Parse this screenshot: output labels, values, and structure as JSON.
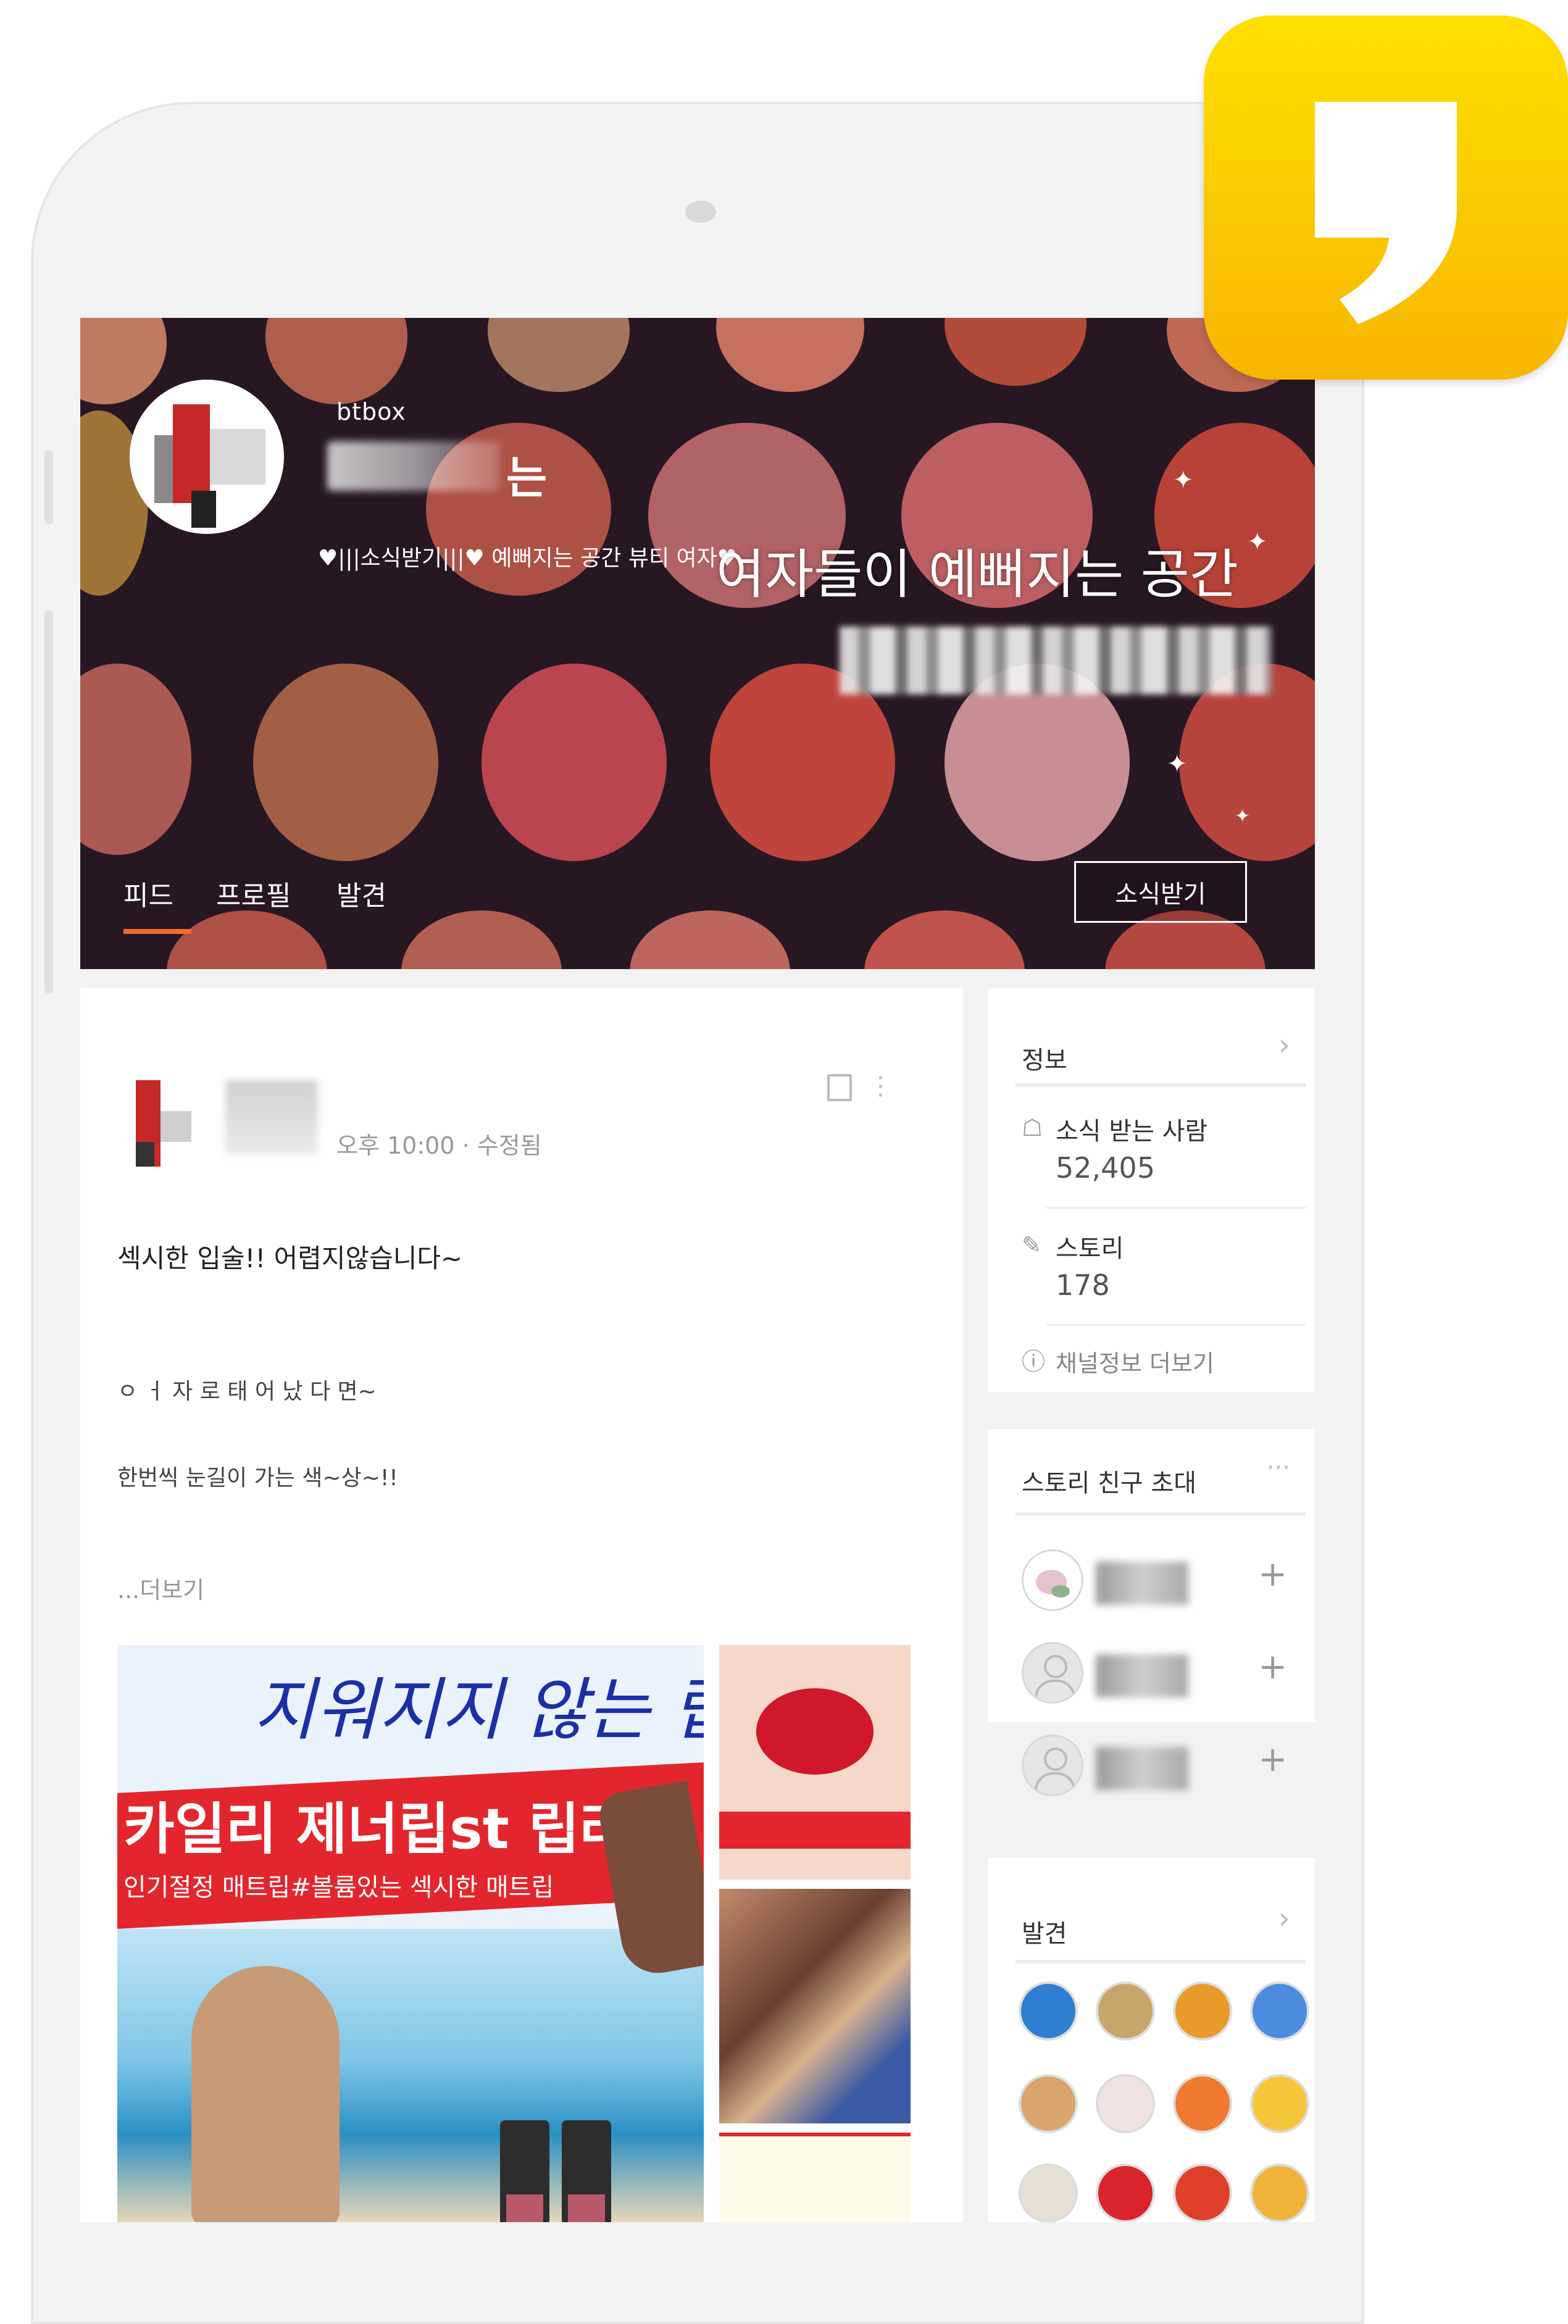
{
  "channel": {
    "id": "btbox",
    "name_tail": "는",
    "description": "♥|||소식받기|||♥ 예뻐지는 공간 뷰티 여자♥",
    "cover_headline": "여자들이 예뻐지는 공간",
    "tabs": [
      {
        "label": "피드"
      },
      {
        "label": "프로필"
      },
      {
        "label": "발견"
      }
    ],
    "subscribe_label": "소식받기"
  },
  "post": {
    "time": "오후 10:00 · 수정됨",
    "lines": [
      "섹시한 입술!! 어렵지않습니다~",
      "ㅇ ㅓ 자 로 태 어 났 다 면~",
      "한번씩 눈길이 가는 색~상~!!"
    ],
    "more_label": "...더보기",
    "image": {
      "headline": "지워지지 않는 립",
      "band_title": "카일리 제너립st 립라커",
      "band_sub": "인기절정 매트립#볼륨있는 섹시한 매트립"
    }
  },
  "info_card": {
    "title": "정보",
    "subscribers_label": "소식 받는 사람",
    "subscribers_value": "52,405",
    "stories_label": "스토리",
    "stories_value": "178",
    "more_label": "채널정보 더보기"
  },
  "invite_card": {
    "title": "스토리 친구 초대",
    "menu": "···",
    "add_symbol": "+"
  },
  "discover_card": {
    "title": "발견"
  },
  "colors": {
    "kakao_yellow": "#FFD400",
    "tab_accent": "#F26B2A",
    "promo_red": "#E3262D",
    "promo_blue": "#1B2FA6"
  }
}
